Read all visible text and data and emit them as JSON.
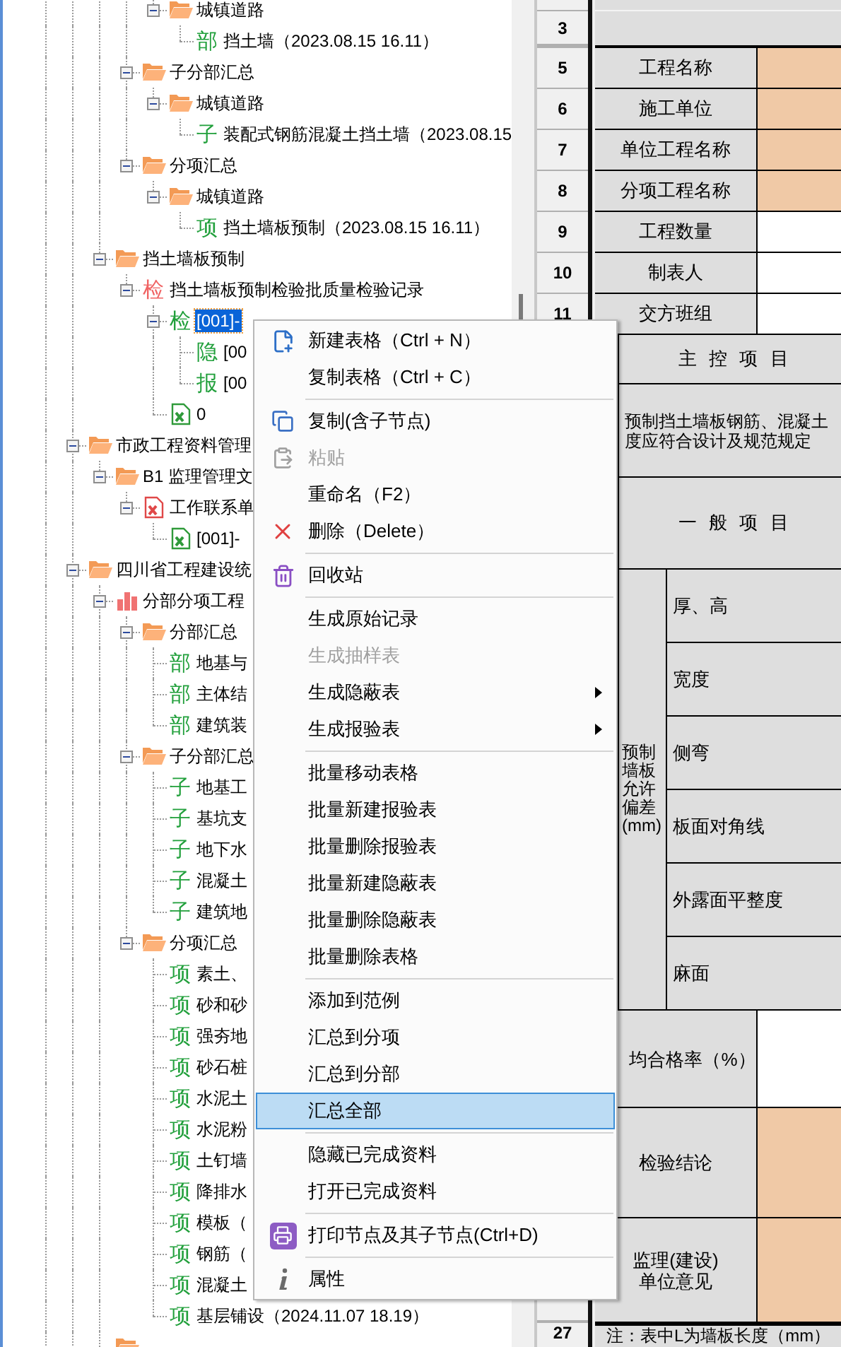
{
  "tree": [
    {
      "children": [
        {
          "children": [
            {
              "children": [
                {
                  "label": "城镇道路",
                  "kind": "folder",
                  "expanded": true,
                  "selected": false,
                  "children": [
                    {
                      "label": "挡土墙（2023.08.15 16.11）",
                      "kind": "badge",
                      "badge": "部",
                      "color": "#22a03c",
                      "selected": false
                    }
                  ]
                }
              ]
            },
            {
              "label": "子分部汇总",
              "kind": "folder",
              "expanded": true,
              "selected": false,
              "children": [
                {
                  "label": "城镇道路",
                  "kind": "folder",
                  "expanded": true,
                  "selected": false,
                  "children": [
                    {
                      "label": "装配式钢筋混凝土挡土墙（2023.08.15",
                      "kind": "badge",
                      "badge": "子",
                      "color": "#22a03c",
                      "selected": false
                    }
                  ]
                }
              ]
            },
            {
              "label": "分项汇总",
              "kind": "folder",
              "expanded": true,
              "selected": false,
              "children": [
                {
                  "label": "城镇道路",
                  "kind": "folder",
                  "expanded": true,
                  "selected": false,
                  "children": [
                    {
                      "label": "挡土墙板预制（2023.08.15 16.11）",
                      "kind": "badge",
                      "badge": "项",
                      "color": "#22a03c",
                      "selected": false
                    }
                  ]
                }
              ]
            }
          ]
        },
        {
          "label": "挡土墙板预制",
          "kind": "folder",
          "expanded": true,
          "selected": false,
          "children": [
            {
              "label": "挡土墙板预制检验批质量检验记录",
              "kind": "badge",
              "badge": "检",
              "color": "#f06464",
              "expanded": true,
              "selected": false,
              "children": [
                {
                  "label": "[001]-",
                  "kind": "badge",
                  "badge": "检",
                  "color": "#22a03c",
                  "expanded": true,
                  "selected": true,
                  "children": [
                    {
                      "label": "[00",
                      "kind": "badge",
                      "badge": "隐",
                      "color": "#22a03c",
                      "selected": false
                    },
                    {
                      "label": "[00",
                      "kind": "badge",
                      "badge": "报",
                      "color": "#22a03c",
                      "selected": false
                    }
                  ]
                },
                {
                  "label": "0",
                  "kind": "excel",
                  "selected": false
                }
              ]
            }
          ]
        }
      ]
    },
    {
      "label": "市政工程资料管理",
      "kind": "folder",
      "expanded": true,
      "selected": false,
      "children": [
        {
          "label": "B1 监理管理文",
          "kind": "folder",
          "expanded": true,
          "selected": false,
          "children": [
            {
              "label": "工作联系单",
              "kind": "excel_error",
              "expanded": true,
              "selected": false,
              "children": [
                {
                  "label": "[001]-",
                  "kind": "excel",
                  "selected": false
                }
              ]
            }
          ]
        }
      ]
    },
    {
      "label": "四川省工程建设统",
      "kind": "folder",
      "expanded": true,
      "selected": false,
      "children": [
        {
          "label": "分部分项工程",
          "kind": "chart",
          "expanded": true,
          "selected": false,
          "children": [
            {
              "label": "分部汇总",
              "kind": "folder",
              "expanded": true,
              "selected": false,
              "children": [
                {
                  "label": "地基与",
                  "kind": "badge",
                  "badge": "部",
                  "color": "#22a03c",
                  "selected": false
                },
                {
                  "label": "主体结",
                  "kind": "badge",
                  "badge": "部",
                  "color": "#22a03c",
                  "selected": false
                },
                {
                  "label": "建筑装",
                  "kind": "badge",
                  "badge": "部",
                  "color": "#22a03c",
                  "selected": false
                }
              ]
            },
            {
              "label": "子分部汇总",
              "kind": "folder",
              "expanded": true,
              "selected": false,
              "children": [
                {
                  "label": "地基工",
                  "kind": "badge",
                  "badge": "子",
                  "color": "#22a03c",
                  "selected": false
                },
                {
                  "label": "基坑支",
                  "kind": "badge",
                  "badge": "子",
                  "color": "#22a03c",
                  "selected": false
                },
                {
                  "label": "地下水",
                  "kind": "badge",
                  "badge": "子",
                  "color": "#22a03c",
                  "selected": false
                },
                {
                  "label": "混凝土",
                  "kind": "badge",
                  "badge": "子",
                  "color": "#22a03c",
                  "selected": false
                },
                {
                  "label": "建筑地",
                  "kind": "badge",
                  "badge": "子",
                  "color": "#22a03c",
                  "selected": false
                }
              ]
            },
            {
              "label": "分项汇总",
              "kind": "folder",
              "expanded": true,
              "selected": false,
              "children": [
                {
                  "label": "素土、",
                  "kind": "badge",
                  "badge": "项",
                  "color": "#22a03c",
                  "selected": false
                },
                {
                  "label": "砂和砂",
                  "kind": "badge",
                  "badge": "项",
                  "color": "#22a03c",
                  "selected": false
                },
                {
                  "label": "强夯地",
                  "kind": "badge",
                  "badge": "项",
                  "color": "#22a03c",
                  "selected": false
                },
                {
                  "label": "砂石桩",
                  "kind": "badge",
                  "badge": "项",
                  "color": "#22a03c",
                  "selected": false
                },
                {
                  "label": "水泥土",
                  "kind": "badge",
                  "badge": "项",
                  "color": "#22a03c",
                  "selected": false
                },
                {
                  "label": "水泥粉",
                  "kind": "badge",
                  "badge": "项",
                  "color": "#22a03c",
                  "selected": false
                },
                {
                  "label": "土钉墙",
                  "kind": "badge",
                  "badge": "项",
                  "color": "#22a03c",
                  "selected": false
                },
                {
                  "label": "降排水",
                  "kind": "badge",
                  "badge": "项",
                  "color": "#22a03c",
                  "selected": false
                },
                {
                  "label": "模板（",
                  "kind": "badge",
                  "badge": "项",
                  "color": "#22a03c",
                  "selected": false
                },
                {
                  "label": "钢筋（",
                  "kind": "badge",
                  "badge": "项",
                  "color": "#22a03c",
                  "selected": false
                },
                {
                  "label": "混凝土",
                  "kind": "badge",
                  "badge": "项",
                  "color": "#22a03c",
                  "selected": false
                },
                {
                  "label": "基层铺设（2024.11.07 18.19）",
                  "kind": "badge",
                  "badge": "项",
                  "color": "#22a03c",
                  "selected": false
                }
              ]
            }
          ]
        },
        {
          "kind": "folder"
        }
      ]
    }
  ],
  "sheet": {
    "row_3_header": "3",
    "info_rows": [
      {
        "header": "5",
        "label": "工程名称",
        "highlighted": true
      },
      {
        "header": "6",
        "label": "施工单位",
        "highlighted": true
      },
      {
        "header": "7",
        "label": "单位工程名称",
        "highlighted": true
      },
      {
        "header": "8",
        "label": "分项工程名称",
        "highlighted": true
      },
      {
        "header": "9",
        "label": "工程数量",
        "highlighted": false
      },
      {
        "header": "10",
        "label": "制表人",
        "highlighted": false
      },
      {
        "header": "11",
        "label": "交方班组",
        "highlighted": false
      }
    ],
    "main_control": {
      "title": "主 控 项 目",
      "text_lines": [
        "预制挡土墙板钢筋、混凝土",
        "度应符合设计及规范规定"
      ]
    },
    "general": {
      "title": "一 般 项 目",
      "group_label": "预制墙板允许偏差(mm)",
      "items": [
        "厚、高",
        "宽度",
        "侧弯",
        "板面对角线",
        "外露面平整度",
        "麻面"
      ]
    },
    "result_rows": [
      {
        "label": "均合格率（%）",
        "highlighted": false
      },
      {
        "label": "检验结论",
        "highlighted": true
      },
      {
        "label": "监理(建设)\n单位意见",
        "highlighted": true
      }
    ],
    "note": {
      "header": "27",
      "text": "注：表中L为墙板长度（mm）"
    }
  },
  "context_menu": {
    "items": [
      {
        "kind": "new",
        "label": "新建表格（Ctrl + N）",
        "disabled": false,
        "selected": false,
        "submenu": false
      },
      {
        "kind": "plain",
        "label": "复制表格（Ctrl + C）",
        "disabled": false,
        "selected": false,
        "submenu": false
      },
      {
        "kind": "separator"
      },
      {
        "kind": "copy",
        "label": "复制(含子节点)",
        "disabled": false,
        "selected": false,
        "submenu": false
      },
      {
        "kind": "paste",
        "label": "粘贴",
        "disabled": true,
        "selected": false,
        "submenu": false
      },
      {
        "kind": "plain",
        "label": "重命名（F2）",
        "disabled": false,
        "selected": false,
        "submenu": false
      },
      {
        "kind": "delete",
        "label": "删除（Delete）",
        "disabled": false,
        "selected": false,
        "submenu": false
      },
      {
        "kind": "separator"
      },
      {
        "kind": "trash",
        "label": "回收站",
        "disabled": false,
        "selected": false,
        "submenu": false
      },
      {
        "kind": "separator"
      },
      {
        "kind": "plain",
        "label": "生成原始记录",
        "disabled": false,
        "selected": false,
        "submenu": false
      },
      {
        "kind": "plain",
        "label": "生成抽样表",
        "disabled": true,
        "selected": false,
        "submenu": false
      },
      {
        "kind": "plain",
        "label": "生成隐蔽表",
        "disabled": false,
        "selected": false,
        "submenu": true
      },
      {
        "kind": "plain",
        "label": "生成报验表",
        "disabled": false,
        "selected": false,
        "submenu": true
      },
      {
        "kind": "separator"
      },
      {
        "kind": "plain",
        "label": "批量移动表格",
        "disabled": false,
        "selected": false,
        "submenu": false
      },
      {
        "kind": "plain",
        "label": "批量新建报验表",
        "disabled": false,
        "selected": false,
        "submenu": false
      },
      {
        "kind": "plain",
        "label": "批量删除报验表",
        "disabled": false,
        "selected": false,
        "submenu": false
      },
      {
        "kind": "plain",
        "label": "批量新建隐蔽表",
        "disabled": false,
        "selected": false,
        "submenu": false
      },
      {
        "kind": "plain",
        "label": "批量删除隐蔽表",
        "disabled": false,
        "selected": false,
        "submenu": false
      },
      {
        "kind": "plain",
        "label": "批量删除表格",
        "disabled": false,
        "selected": false,
        "submenu": false
      },
      {
        "kind": "separator"
      },
      {
        "kind": "plain",
        "label": "添加到范例",
        "disabled": false,
        "selected": false,
        "submenu": false
      },
      {
        "kind": "plain",
        "label": "汇总到分项",
        "disabled": false,
        "selected": false,
        "submenu": false
      },
      {
        "kind": "plain",
        "label": "汇总到分部",
        "disabled": false,
        "selected": false,
        "submenu": false
      },
      {
        "kind": "plain",
        "label": "汇总全部",
        "disabled": false,
        "selected": true,
        "submenu": false
      },
      {
        "kind": "separator"
      },
      {
        "kind": "plain",
        "label": "隐藏已完成资料",
        "disabled": false,
        "selected": false,
        "submenu": false
      },
      {
        "kind": "plain",
        "label": "打开已完成资料",
        "disabled": false,
        "selected": false,
        "submenu": false
      },
      {
        "kind": "separator"
      },
      {
        "kind": "print",
        "label": "打印节点及其子节点(Ctrl+D)",
        "disabled": false,
        "selected": false,
        "submenu": false
      },
      {
        "kind": "separator"
      },
      {
        "kind": "info",
        "label": "属性",
        "disabled": false,
        "selected": false,
        "submenu": false
      }
    ]
  }
}
